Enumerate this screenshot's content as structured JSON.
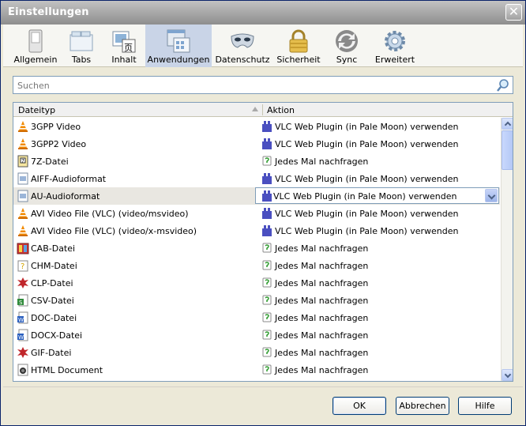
{
  "window": {
    "title": "Einstellungen",
    "close_label": "✕"
  },
  "toolbar": {
    "tabs": [
      {
        "label": "Allgemein",
        "icon": "switch-icon"
      },
      {
        "label": "Tabs",
        "icon": "tabs-icon"
      },
      {
        "label": "Inhalt",
        "icon": "content-icon"
      },
      {
        "label": "Anwendungen",
        "icon": "applications-icon",
        "active": true
      },
      {
        "label": "Datenschutz",
        "icon": "mask-icon"
      },
      {
        "label": "Sicherheit",
        "icon": "lock-icon"
      },
      {
        "label": "Sync",
        "icon": "sync-icon"
      },
      {
        "label": "Erweitert",
        "icon": "gear-icon"
      }
    ]
  },
  "search": {
    "placeholder": "Suchen"
  },
  "table": {
    "headers": {
      "type": "Dateityp",
      "action": "Aktion"
    },
    "rows": [
      {
        "type": "3GPP Video",
        "action": "VLC Web Plugin (in Pale Moon) verwenden"
      },
      {
        "type": "3GPP2 Video",
        "action": "VLC Web Plugin (in Pale Moon) verwenden"
      },
      {
        "type": "7Z-Datei",
        "action": "Jedes Mal nachfragen"
      },
      {
        "type": "AIFF-Audioformat",
        "action": "VLC Web Plugin (in Pale Moon) verwenden"
      },
      {
        "type": "AU-Audioformat",
        "action": "VLC Web Plugin (in Pale Moon) verwenden",
        "selected": true
      },
      {
        "type": "AVI Video File (VLC) (video/msvideo)",
        "action": "VLC Web Plugin (in Pale Moon) verwenden"
      },
      {
        "type": "AVI Video File (VLC) (video/x-msvideo)",
        "action": "VLC Web Plugin (in Pale Moon) verwenden"
      },
      {
        "type": "CAB-Datei",
        "action": "Jedes Mal nachfragen"
      },
      {
        "type": "CHM-Datei",
        "action": "Jedes Mal nachfragen"
      },
      {
        "type": "CLP-Datei",
        "action": "Jedes Mal nachfragen"
      },
      {
        "type": "CSV-Datei",
        "action": "Jedes Mal nachfragen"
      },
      {
        "type": "DOC-Datei",
        "action": "Jedes Mal nachfragen"
      },
      {
        "type": "DOCX-Datei",
        "action": "Jedes Mal nachfragen"
      },
      {
        "type": "GIF-Datei",
        "action": "Jedes Mal nachfragen"
      },
      {
        "type": "HTML Document",
        "action": "Jedes Mal nachfragen"
      }
    ]
  },
  "buttons": {
    "ok": "OK",
    "cancel": "Abbrechen",
    "help": "Hilfe"
  },
  "colors": {
    "accent": "#c9d4e7",
    "plugin": "#4a4fc0",
    "vlc": "#f28a00"
  }
}
